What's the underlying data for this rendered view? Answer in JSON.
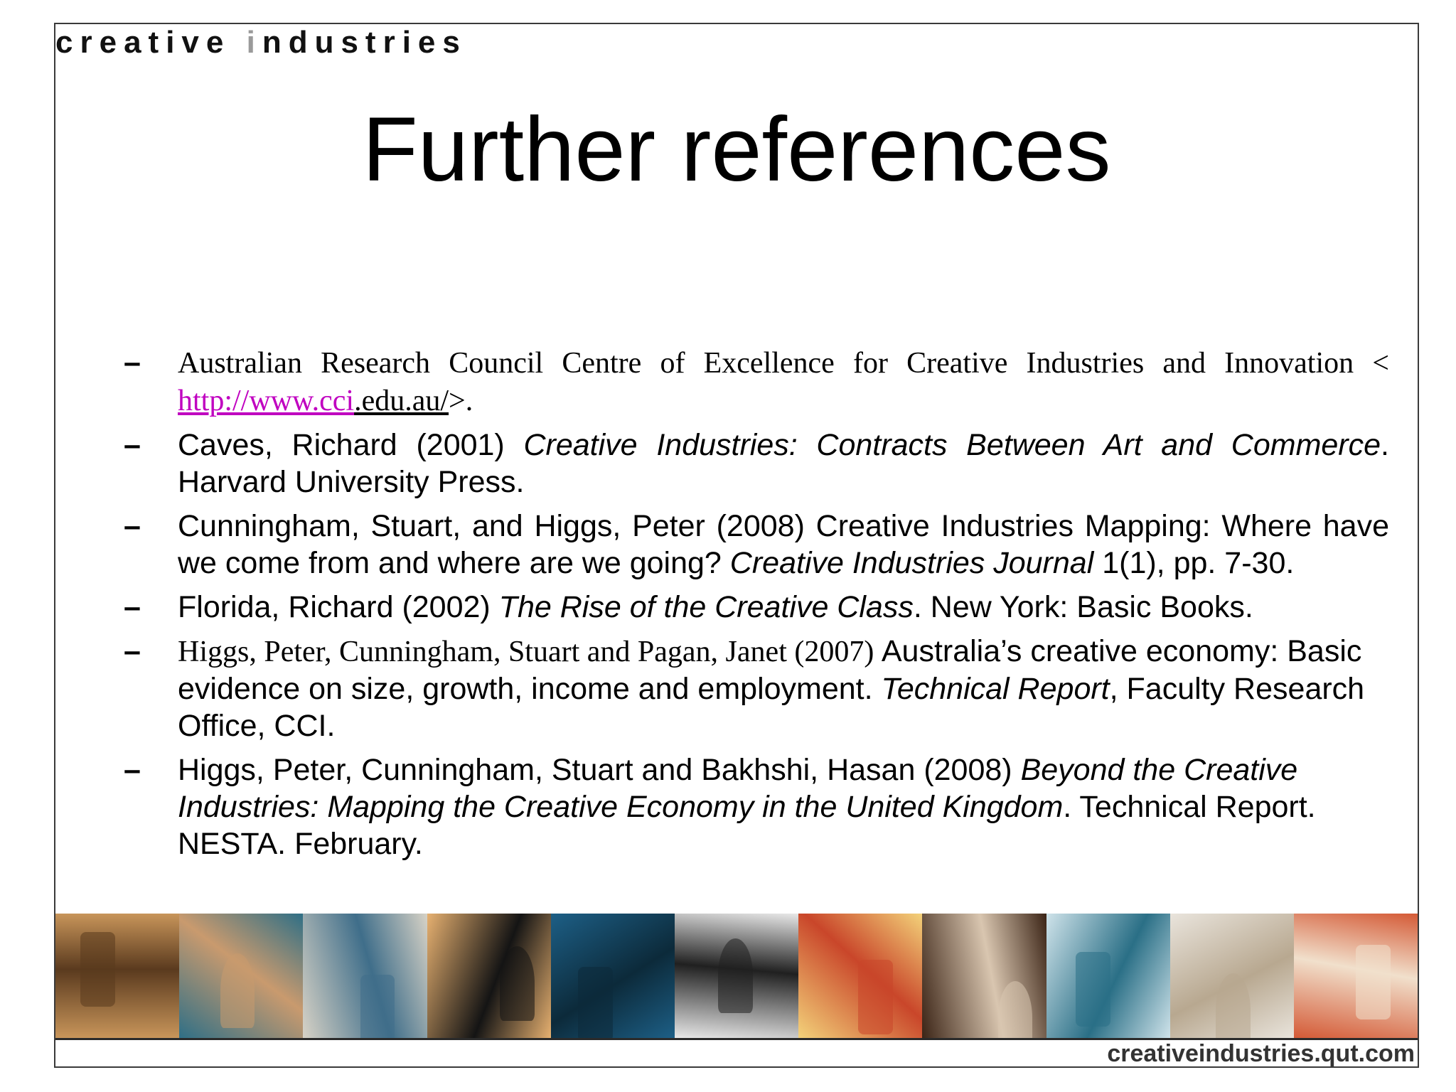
{
  "header": {
    "brand_part1": "creative ",
    "brand_highlight": "i",
    "brand_part2": "ndustries"
  },
  "title": "Further references",
  "references": [
    {
      "marker": "–",
      "text_start": "Australian Research Council Centre of Excellence for Creative Industries and Innovation < ",
      "link_part1": "http://www.cci",
      "link_part2": ".edu.au/",
      "text_end": ">."
    },
    {
      "marker": "–",
      "text_start": "Caves, Richard (2001) ",
      "italic": "Creative Industries: Contracts Between Art and Commerce",
      "text_end": ". Harvard University Press."
    },
    {
      "marker": "–",
      "text_start": "Cunningham, Stuart, and Higgs, Peter (2008) Creative Industries Mapping: Where have we come from and where are we going? ",
      "italic": "Creative Industries Journal",
      "text_end": " 1(1), pp. 7-30."
    },
    {
      "marker": "–",
      "text_start": "Florida, Richard (2002) ",
      "italic": "The Rise of the Creative Class",
      "text_end": ". New York: Basic Books."
    },
    {
      "marker": "–",
      "text_serif": "Higgs, Peter, Cunningham, Stuart and Pagan, Janet (2007) ",
      "text_start": "Australia’s creative economy: Basic evidence on size, growth, income and employment. ",
      "italic": "Technical Report",
      "text_end": ", Faculty Research Office, CCI."
    },
    {
      "marker": "–",
      "text_start": "Higgs, Peter, Cunningham, Stuart and Bakhshi, Hasan (2008) ",
      "italic": "Beyond the Creative Industries: Mapping the Creative Economy in the United Kingdom",
      "text_end": ". Technical Report. NESTA. February."
    }
  ],
  "image_strip": [
    {
      "icon": "dancer-photo",
      "c1": "#c8955a",
      "c2": "#5a3a1e"
    },
    {
      "icon": "arch-building-photo",
      "c1": "#2f6f86",
      "c2": "#c99a6e"
    },
    {
      "icon": "balconies-photo",
      "c1": "#d7d2c6",
      "c2": "#3f6e8a"
    },
    {
      "icon": "silhouette-figures-photo",
      "c1": "#e6b070",
      "c2": "#141414"
    },
    {
      "icon": "blue-texture-photo",
      "c1": "#1d5f86",
      "c2": "#0c2a3a"
    },
    {
      "icon": "stripes-photo",
      "c1": "#e8e8e8",
      "c2": "#202020"
    },
    {
      "icon": "yellow-corridor-photo",
      "c1": "#f3d27a",
      "c2": "#c9462a"
    },
    {
      "icon": "crossed-beams-photo",
      "c1": "#3b2416",
      "c2": "#d9c6b0"
    },
    {
      "icon": "blue-figure-photo",
      "c1": "#cfe3ea",
      "c2": "#2a6f86"
    },
    {
      "icon": "standing-figure-photo",
      "c1": "#e9e4dc",
      "c2": "#b8a890"
    },
    {
      "icon": "red-chairs-photo",
      "c1": "#d45a36",
      "c2": "#f1e0cc"
    }
  ],
  "footer": {
    "url": "creativeindustries.qut.com"
  }
}
